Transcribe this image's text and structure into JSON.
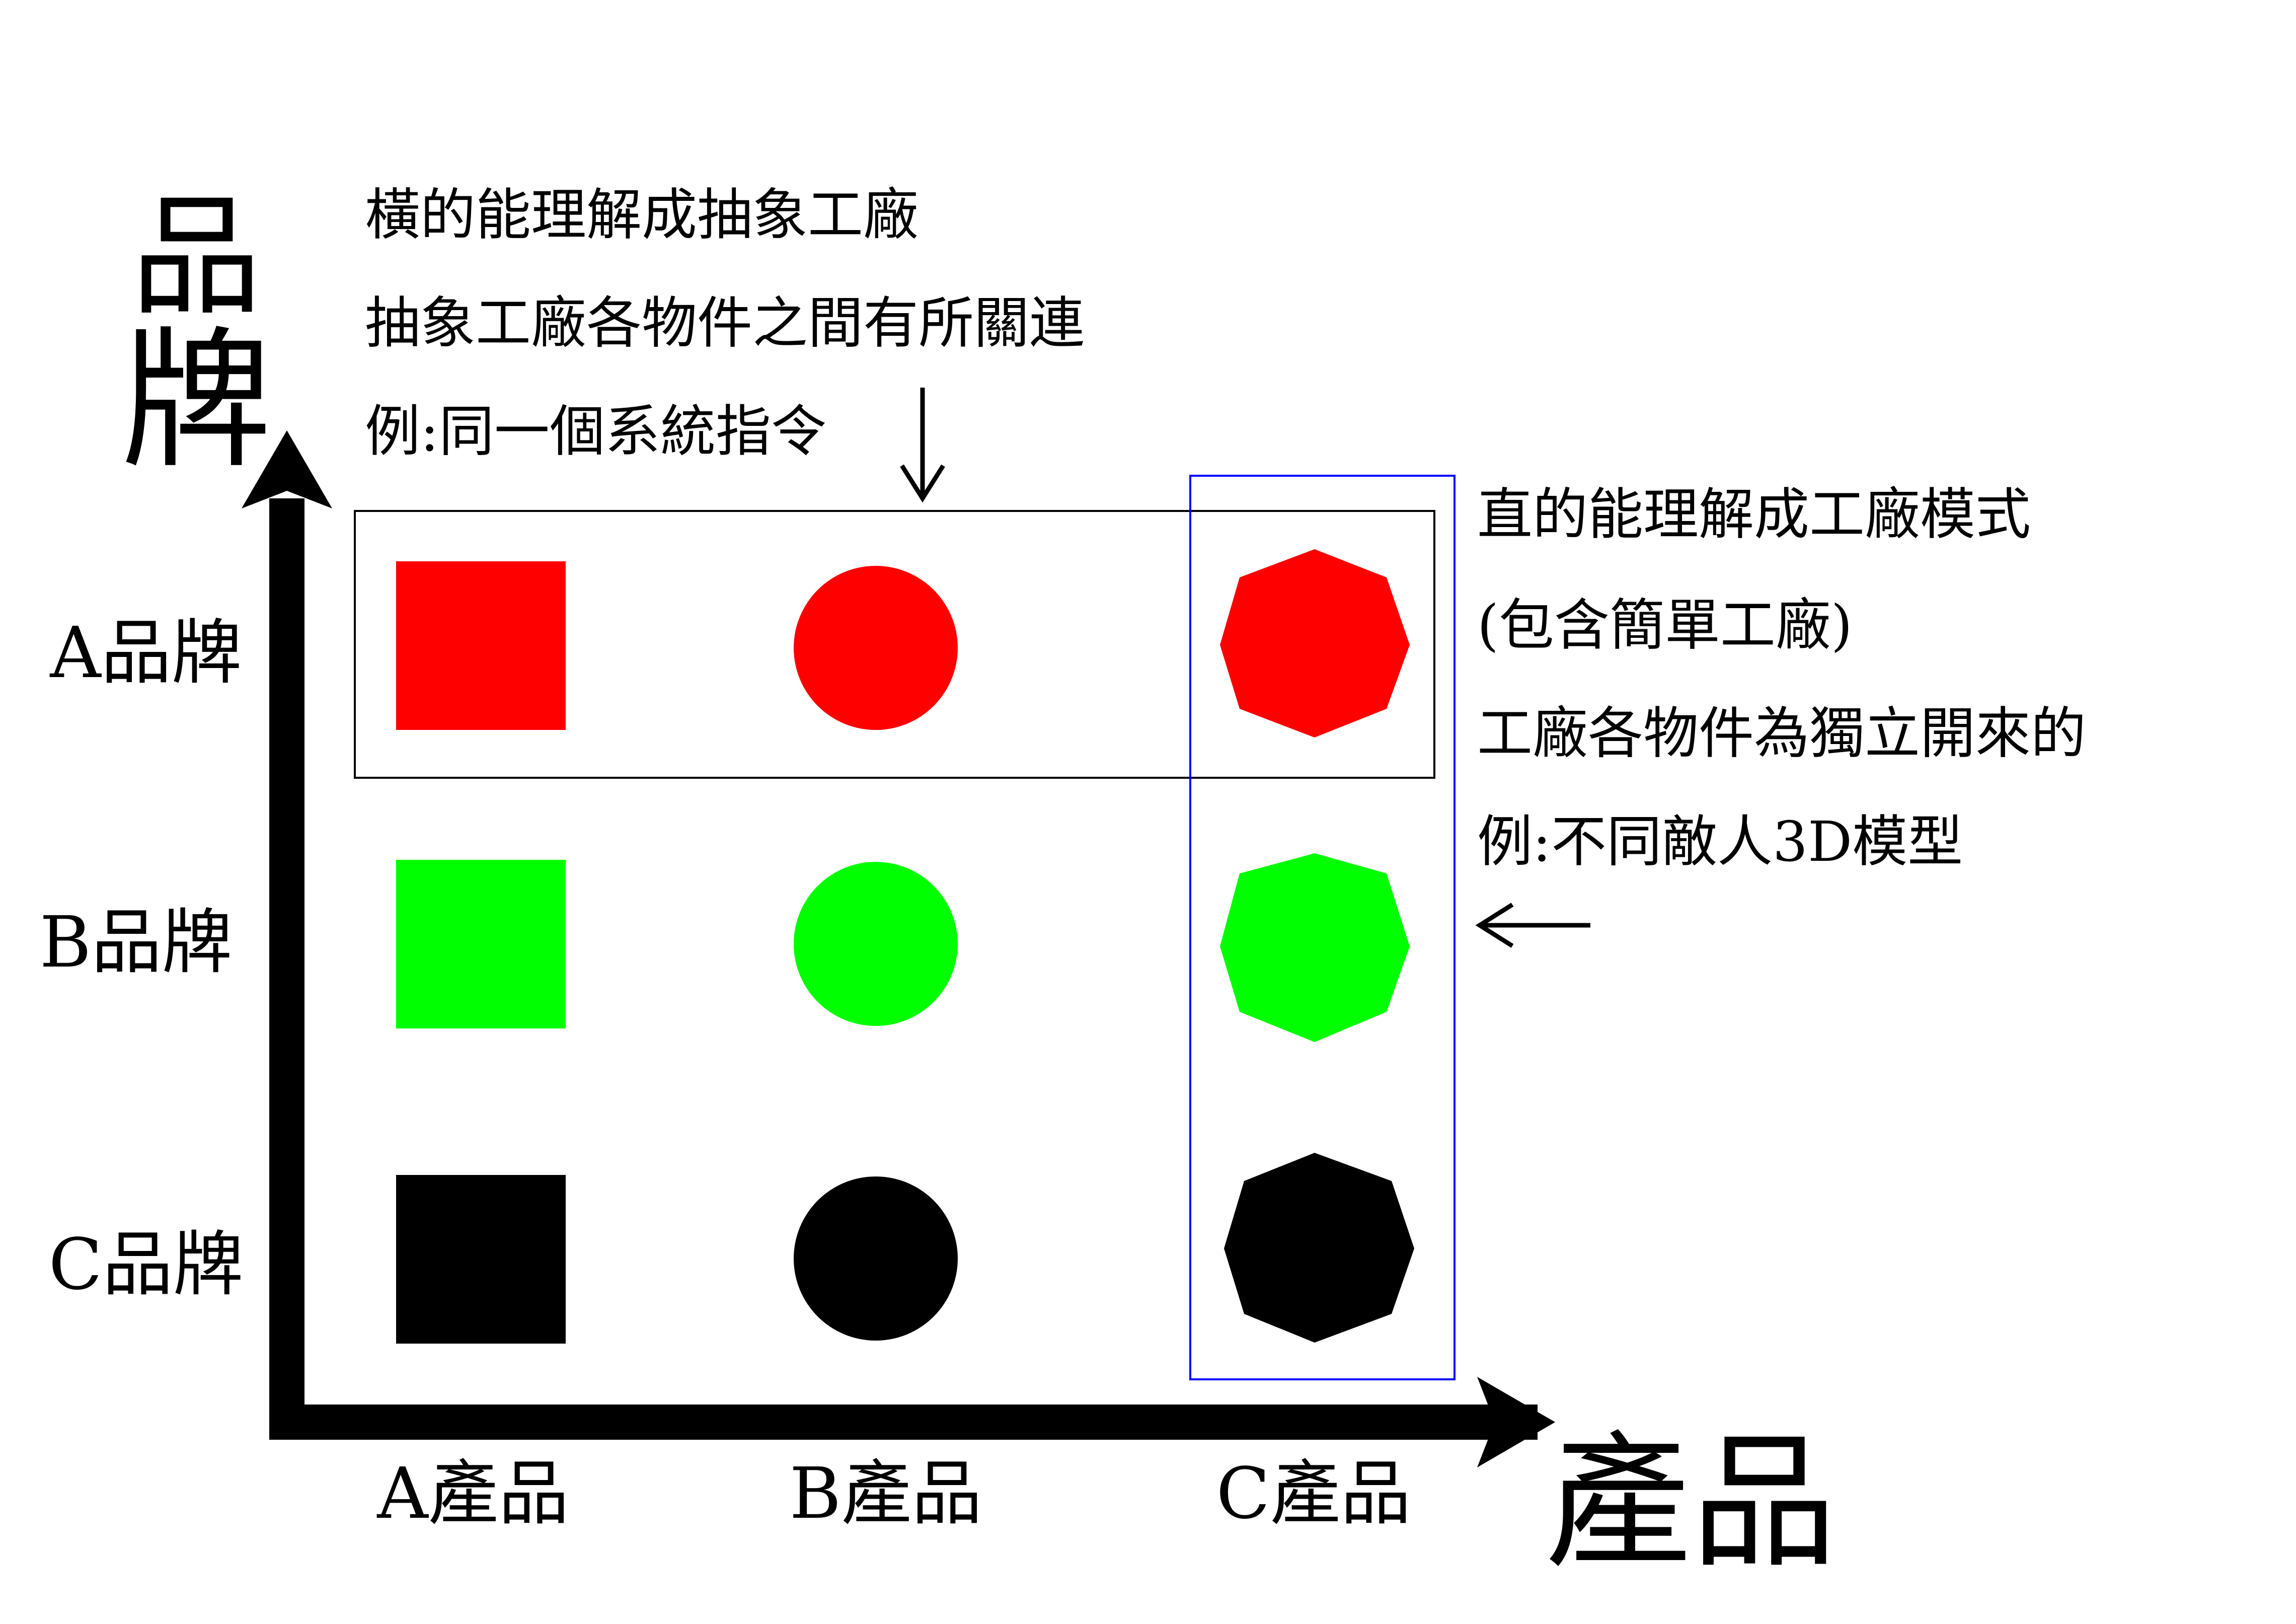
{
  "axes": {
    "y_title_line1": "品",
    "y_title_line2": "牌",
    "x_title": "產品"
  },
  "brands": [
    "A品牌",
    "B品牌",
    "C品牌"
  ],
  "products": [
    "A產品",
    "B產品",
    "C產品"
  ],
  "colors": {
    "brand_a": "#ff0000",
    "brand_b": "#00ff00",
    "brand_c": "#000000",
    "row_box": "#000000",
    "column_box": "#0000ff"
  },
  "shapes": [
    "square",
    "circle",
    "octagon"
  ],
  "annotation_top": [
    "橫的能理解成抽象工廠",
    "抽象工廠各物件之間有所關連",
    "例:同一個系統指令"
  ],
  "annotation_right": [
    "直的能理解成工廠模式",
    "(包含簡單工廠)",
    "工廠各物件為獨立開來的",
    "例:不同敵人3D模型"
  ]
}
